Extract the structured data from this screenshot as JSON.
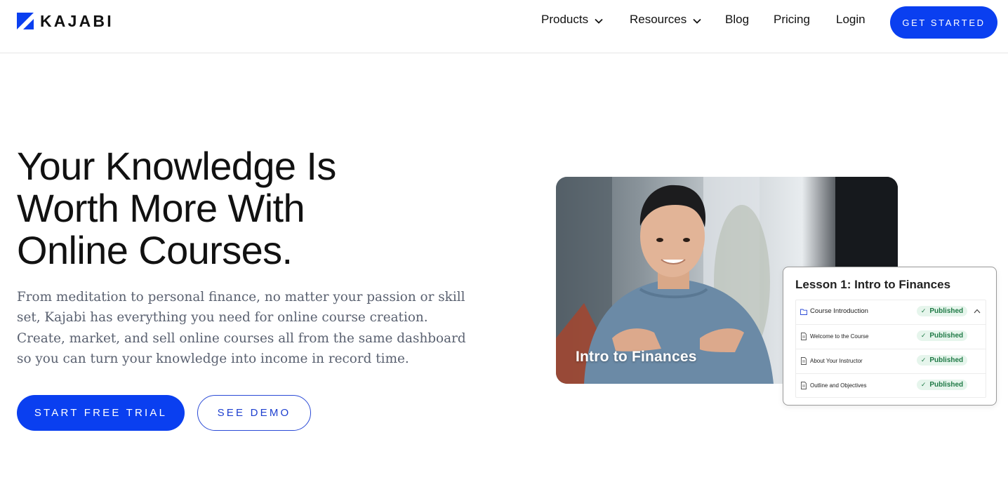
{
  "header": {
    "brand": "KAJABI",
    "nav": [
      {
        "label": "Products",
        "has_dropdown": true
      },
      {
        "label": "Resources",
        "has_dropdown": true
      },
      {
        "label": "Blog",
        "has_dropdown": false
      },
      {
        "label": "Pricing",
        "has_dropdown": false
      },
      {
        "label": "Login",
        "has_dropdown": false
      }
    ],
    "cta_label": "GET STARTED"
  },
  "hero": {
    "title_lines": [
      "Your Knowledge Is",
      "Worth More With",
      "Online Courses."
    ],
    "description_lines": [
      "From meditation to personal finance, no matter your passion or skill",
      "set, Kajabi has everything you need for online course creation.",
      "Create, market, and sell online courses all from the same dashboard",
      "so you can turn your knowledge into income in record time."
    ],
    "primary_button": "START FREE TRIAL",
    "secondary_button": "SEE DEMO"
  },
  "video": {
    "caption": "Intro to Finances"
  },
  "lesson_panel": {
    "title": "Lesson 1: Intro to Finances",
    "rows": [
      {
        "label": "Course Introduction",
        "status": "Published",
        "icon": "folder-icon"
      },
      {
        "label": "Welcome to the Course",
        "status": "Published",
        "icon": "document-icon"
      },
      {
        "label": "About Your Instructor",
        "status": "Published",
        "icon": "document-icon"
      },
      {
        "label": "Outline and Objectives",
        "status": "Published",
        "icon": "document-icon"
      }
    ]
  },
  "colors": {
    "brand_blue": "#0a3ff0",
    "published_bg": "#e6f5ec",
    "published_text": "#1f7a46"
  }
}
